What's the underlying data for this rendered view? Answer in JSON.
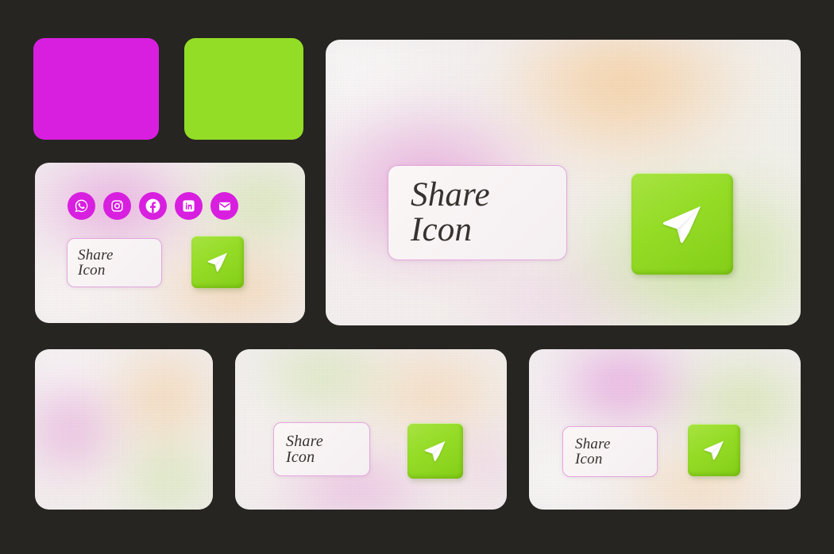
{
  "theme": {
    "background": "#262522",
    "magenta": "#D81FE0",
    "green": "#93DD26",
    "pill_border": "#E3A6DD",
    "text": "#36322F"
  },
  "swatches": [
    {
      "name": "magenta-swatch",
      "color": "#D81FE0"
    },
    {
      "name": "green-swatch",
      "color": "#93DD26"
    }
  ],
  "social": {
    "items": [
      {
        "icon": "whatsapp-icon",
        "label": "WhatsApp"
      },
      {
        "icon": "instagram-icon",
        "label": "Instagram"
      },
      {
        "icon": "facebook-icon",
        "label": "Facebook"
      },
      {
        "icon": "linkedin-icon",
        "label": "LinkedIn"
      },
      {
        "icon": "mail-icon",
        "label": "Email"
      }
    ]
  },
  "share": {
    "label": "Share\nIcon",
    "send_icon": "send-paper-plane-icon"
  },
  "cards": {
    "social_card": {
      "name": "social-share-card"
    },
    "hero_card": {
      "name": "hero-share-card"
    },
    "blank_card": {
      "name": "gradient-swatch-card"
    },
    "mid_card": {
      "name": "share-card-variant-2"
    },
    "right_card": {
      "name": "share-card-variant-3"
    }
  }
}
